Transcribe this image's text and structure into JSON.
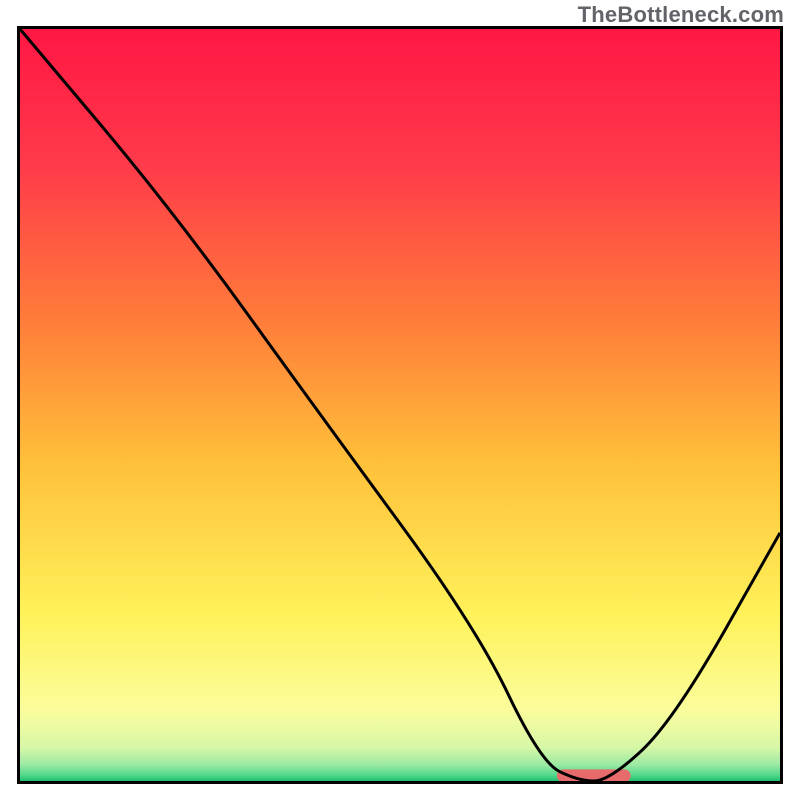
{
  "domain": "Chart",
  "watermark": "TheBottleneck.com",
  "chart_data": {
    "type": "line",
    "title": "",
    "xlabel": "",
    "ylabel": "",
    "xlim": [
      0,
      1
    ],
    "ylim": [
      0,
      1
    ],
    "x": [
      0.0,
      0.2,
      0.4,
      0.6,
      0.685,
      0.735,
      0.775,
      0.86,
      1.0
    ],
    "values": [
      1.0,
      0.76,
      0.48,
      0.205,
      0.025,
      0.0,
      0.0,
      0.08,
      0.33
    ],
    "valley_marker": {
      "x_start": 0.715,
      "x_end": 0.795,
      "y": 0.007,
      "color": "#e86b6c",
      "radius": 0.01,
      "stroke_width": 0.017
    },
    "gradient_stops": [
      {
        "pos": 0.0,
        "color": "#ff1744"
      },
      {
        "pos": 0.18,
        "color": "#ff3a4a"
      },
      {
        "pos": 0.38,
        "color": "#ff7a3a"
      },
      {
        "pos": 0.58,
        "color": "#ffc13a"
      },
      {
        "pos": 0.78,
        "color": "#fff25a"
      },
      {
        "pos": 0.905,
        "color": "#fbfd9c"
      },
      {
        "pos": 0.955,
        "color": "#d7f7a6"
      },
      {
        "pos": 0.978,
        "color": "#9ce9a3"
      },
      {
        "pos": 0.992,
        "color": "#54d98c"
      },
      {
        "pos": 1.0,
        "color": "#1fbf6f"
      }
    ],
    "curve_color": "#000000",
    "curve_width": 3
  }
}
